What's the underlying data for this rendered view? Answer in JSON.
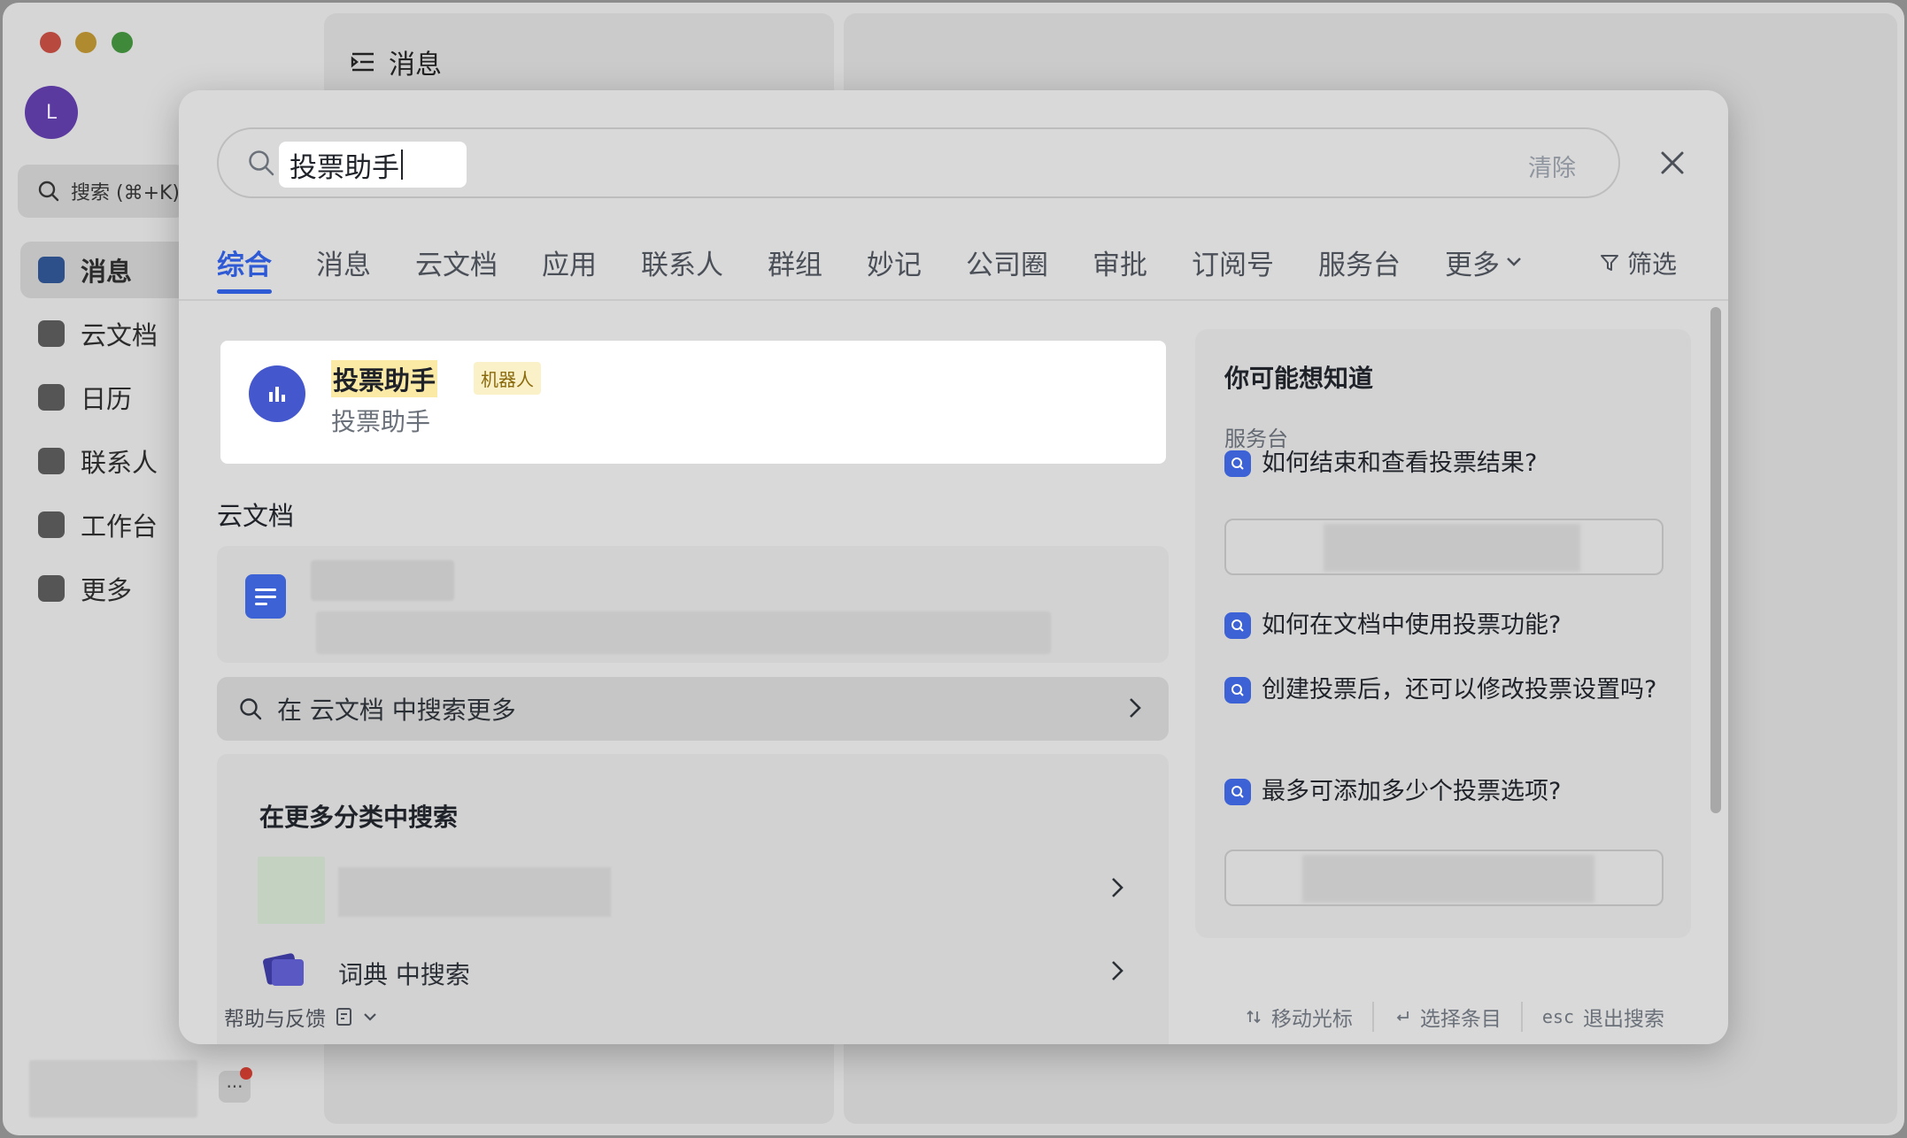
{
  "app": {
    "avatar_letter": "L",
    "search_placeholder": "搜索 (⌘+K)",
    "nav": [
      {
        "label": "消息",
        "icon": "message-icon",
        "active": true
      },
      {
        "label": "云文档",
        "icon": "docs-icon"
      },
      {
        "label": "日历",
        "icon": "calendar-icon"
      },
      {
        "label": "联系人",
        "icon": "contacts-icon"
      },
      {
        "label": "工作台",
        "icon": "workplace-icon"
      },
      {
        "label": "更多",
        "icon": "more-apps-icon"
      }
    ],
    "chat_header": "消息",
    "more_dots": "···"
  },
  "search": {
    "query": "投票助手",
    "clear_label": "清除",
    "tabs": [
      "综合",
      "消息",
      "云文档",
      "应用",
      "联系人",
      "群组",
      "妙记",
      "公司圈",
      "审批",
      "订阅号",
      "服务台",
      "更多"
    ],
    "active_tab": "综合",
    "filter_label": "筛选"
  },
  "top_result": {
    "title": "投票助手",
    "tag": "机器人",
    "subtitle": "投票助手"
  },
  "docs_section": {
    "title": "云文档",
    "more_label": "在 云文档 中搜索更多"
  },
  "categories": {
    "title": "在更多分类中搜索",
    "dictionary_label": "词典 中搜索"
  },
  "faq": {
    "title": "你可能想知道",
    "category": "服务台",
    "questions": [
      "如何结束和查看投票结果?",
      "如何在文档中使用投票功能?",
      "创建投票后，还可以修改投票设置吗?",
      "最多可添加多少个投票选项?"
    ]
  },
  "footer": {
    "help_label": "帮助与反馈",
    "move_cursor": "移动光标",
    "select_item": "选择条目",
    "esc_key": "esc",
    "exit_search": "退出搜索"
  },
  "colors": {
    "accent": "#2f5ad6",
    "highlight": "#fbe9a6",
    "bot_avatar": "#4457cc"
  }
}
